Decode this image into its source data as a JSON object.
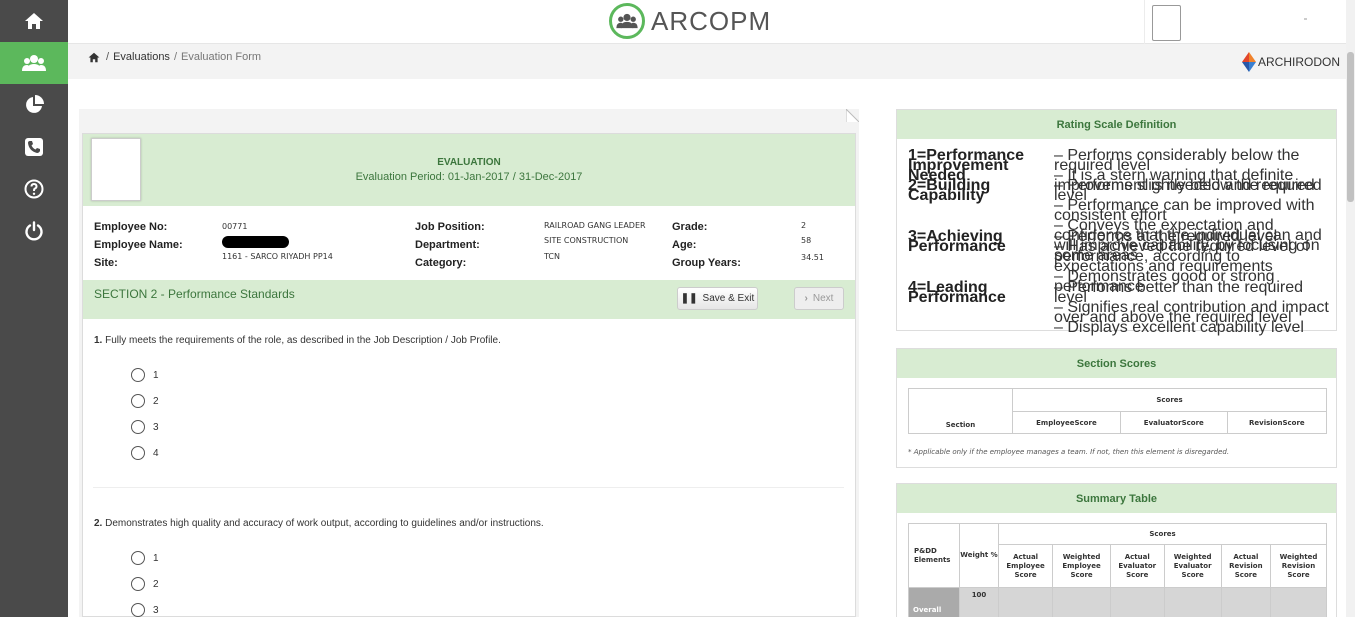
{
  "app": {
    "logo_text": "ARCOPM",
    "brand": "ARCHIRODON"
  },
  "sidebar": {
    "items": [
      {
        "icon": "home-icon"
      },
      {
        "icon": "users-icon",
        "active": true
      },
      {
        "icon": "pie-chart-icon"
      },
      {
        "icon": "phone-icon"
      },
      {
        "icon": "help-icon"
      },
      {
        "icon": "power-icon"
      }
    ]
  },
  "breadcrumb": {
    "sep": "/",
    "evaluations": "Evaluations",
    "sep2": "/",
    "current": "Evaluation Form"
  },
  "evaluation": {
    "title": "EVALUATION",
    "period": "Evaluation Period: 01-Jan-2017 / 31-Dec-2017"
  },
  "employee": {
    "no_label": "Employee No:",
    "no": "00771",
    "name_label": "Employee Name:",
    "site_label": "Site:",
    "site": "1161 - SARCO RIYADH PP14",
    "job_label": "Job Position:",
    "job": "RAILROAD GANG LEADER",
    "dept_label": "Department:",
    "dept": "SITE CONSTRUCTION",
    "cat_label": "Category:",
    "cat": "TCN",
    "grade_label": "Grade:",
    "grade": "2",
    "age_label": "Age:",
    "age": "58",
    "years_label": "Group Years:",
    "years": "34.51"
  },
  "section": {
    "title": "SECTION 2 - Performance Standards",
    "save_label": "Save & Exit",
    "next_label": "Next"
  },
  "questions": [
    {
      "num": "1.",
      "text": "Fully meets the requirements of the role, as described in the Job Description / Job Profile.",
      "options": [
        "1",
        "2",
        "3",
        "4"
      ]
    },
    {
      "num": "2.",
      "text": "Demonstrates high quality and accuracy of work output, according to guidelines and/or instructions.",
      "options": [
        "1",
        "2",
        "3"
      ]
    }
  ],
  "rating_scale": {
    "title": "Rating Scale Definition",
    "rows": [
      {
        "label": "1=Performance Improvement Needed",
        "lines": [
          "–  Performs considerably below the required level",
          "–  It is a stern warning that definite improvement is needed and required"
        ]
      },
      {
        "label": "2=Building Capability",
        "lines": [
          "–  Performs slightly below the required level",
          "–  Performance can be improved with consistent effort",
          "–  Conveys the expectation and confidence that the individual can and will improve capability, by focusing on some areas"
        ]
      },
      {
        "label": "3=Achieving Performance",
        "lines": [
          "–  Performs at the required level",
          "–  Has achieved the required level of performance, according to expectations and requirements",
          "–  Demonstrates good or strong performance"
        ]
      },
      {
        "label": "4=Leading Performance",
        "lines": [
          "–  Performs better than the required level",
          "–  Signifies real contribution and impact over and above the required level",
          "–  Displays excellent capability level"
        ]
      }
    ]
  },
  "section_scores": {
    "title": "Section Scores",
    "scores_header": "Scores",
    "section_col": "Section",
    "cols": [
      "EmployeeScore",
      "EvaluatorScore",
      "RevisionScore"
    ],
    "note": "* Applicable only if the employee manages a team. If not, then this element is disregarded."
  },
  "summary": {
    "title": "Summary Table",
    "scores_header": "Scores",
    "col_elements": "P&DD Elements",
    "col_weight": "Weight %",
    "cols": [
      "Actual Employee Score",
      "Weighted Employee Score",
      "Actual Evaluator Score",
      "Weighted Evaluator Score",
      "Actual Revision Score",
      "Weighted Revision Score"
    ],
    "row_label": "Overall",
    "row_weight": "100"
  }
}
